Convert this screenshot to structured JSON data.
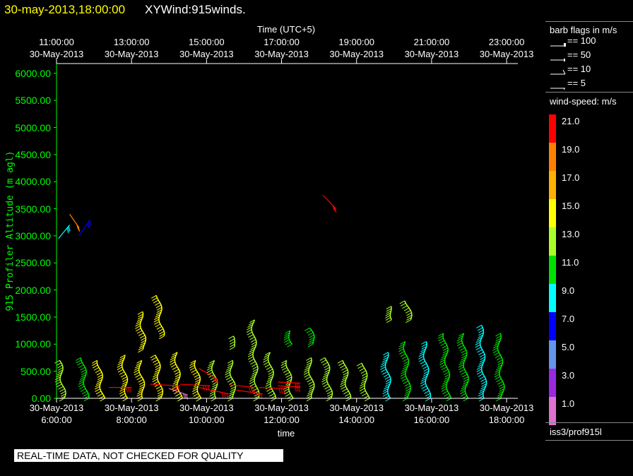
{
  "header": {
    "date": "30-may-2013,18:00:00",
    "title": "XYWind:915winds."
  },
  "chart_data": {
    "type": "wind-barb-time-height",
    "xlabel": "time",
    "x2label": "Time (UTC+5)",
    "ylabel": "915 Profiler Altitude (m agl)",
    "xlim_hours": [
      6.0,
      18.3
    ],
    "ylim": [
      0,
      6180
    ],
    "yticks": [
      "0.00",
      "500.00",
      "1000.00",
      "1500.00",
      "2000.00",
      "2500.00",
      "3000.00",
      "3500.00",
      "4000.00",
      "4500.00",
      "5000.00",
      "5500.00",
      "6000.00"
    ],
    "xticks": [
      {
        "h": 6,
        "date": "30-May-2013",
        "time": "6:00:00"
      },
      {
        "h": 8,
        "date": "30-May-2013",
        "time": "8:00:00"
      },
      {
        "h": 10,
        "date": "30-May-2013",
        "time": "10:00:00"
      },
      {
        "h": 12,
        "date": "30-May-2013",
        "time": "12:00:00"
      },
      {
        "h": 14,
        "date": "30-May-2013",
        "time": "14:00:00"
      },
      {
        "h": 16,
        "date": "30-May-2013",
        "time": "16:00:00"
      },
      {
        "h": 18,
        "date": "30-May-2013",
        "time": "18:00:00"
      }
    ],
    "x2ticks": [
      {
        "h": 6,
        "time": "11:00:00",
        "date": "30-May-2013"
      },
      {
        "h": 8,
        "time": "13:00:00",
        "date": "30-May-2013"
      },
      {
        "h": 10,
        "time": "15:00:00",
        "date": "30-May-2013"
      },
      {
        "h": 12,
        "time": "17:00:00",
        "date": "30-May-2013"
      },
      {
        "h": 14,
        "time": "19:00:00",
        "date": "30-May-2013"
      },
      {
        "h": 16,
        "time": "21:00:00",
        "date": "30-May-2013"
      },
      {
        "h": 18,
        "time": "23:00:00",
        "date": "30-May-2013"
      }
    ],
    "profiles": [
      {
        "t": 6.15,
        "bottom": 0,
        "top": 700,
        "speed": 12
      },
      {
        "t": 6.77,
        "bottom": 0,
        "top": 750,
        "speed": 11
      },
      {
        "t": 7.23,
        "bottom": 0,
        "top": 700,
        "speed": 15
      },
      {
        "t": 7.8,
        "bottom": 0,
        "top": 800,
        "speed": 15
      },
      {
        "t": 8.28,
        "bottom": 0,
        "top": 700,
        "speed": 15
      },
      {
        "t": 8.3,
        "bottom": 900,
        "top": 1600,
        "speed": 15
      },
      {
        "t": 8.77,
        "bottom": 0,
        "top": 800,
        "speed": 15
      },
      {
        "t": 8.8,
        "bottom": 1150,
        "top": 1900,
        "speed": 15
      },
      {
        "t": 9.3,
        "bottom": 0,
        "top": 850,
        "speed": 14
      },
      {
        "t": 9.77,
        "bottom": 0,
        "top": 700,
        "speed": 15
      },
      {
        "t": 10.25,
        "bottom": 0,
        "top": 700,
        "speed": 13
      },
      {
        "t": 10.75,
        "bottom": 0,
        "top": 700,
        "speed": 13
      },
      {
        "t": 10.77,
        "bottom": 950,
        "top": 1150,
        "speed": 13
      },
      {
        "t": 11.28,
        "bottom": 0,
        "top": 1450,
        "speed": 13
      },
      {
        "t": 11.75,
        "bottom": 0,
        "top": 850,
        "speed": 13
      },
      {
        "t": 12.26,
        "bottom": 0,
        "top": 700,
        "speed": 13
      },
      {
        "t": 12.28,
        "bottom": 1000,
        "top": 1250,
        "speed": 11
      },
      {
        "t": 12.77,
        "bottom": 0,
        "top": 750,
        "speed": 12
      },
      {
        "t": 12.79,
        "bottom": 1000,
        "top": 1300,
        "speed": 11
      },
      {
        "t": 13.26,
        "bottom": 0,
        "top": 750,
        "speed": 13
      },
      {
        "t": 13.77,
        "bottom": 0,
        "top": 700,
        "speed": 12
      },
      {
        "t": 14.3,
        "bottom": 0,
        "top": 650,
        "speed": 12
      },
      {
        "t": 14.83,
        "bottom": 0,
        "top": 850,
        "speed": 9
      },
      {
        "t": 14.9,
        "bottom": 1450,
        "top": 1700,
        "speed": 13
      },
      {
        "t": 15.36,
        "bottom": 0,
        "top": 1050,
        "speed": 11
      },
      {
        "t": 15.4,
        "bottom": 1450,
        "top": 1800,
        "speed": 13
      },
      {
        "t": 15.9,
        "bottom": 0,
        "top": 1050,
        "speed": 9
      },
      {
        "t": 16.38,
        "bottom": 0,
        "top": 1200,
        "speed": 10
      },
      {
        "t": 16.9,
        "bottom": 0,
        "top": 1200,
        "speed": 10
      },
      {
        "t": 17.4,
        "bottom": 0,
        "top": 1350,
        "speed": 9
      },
      {
        "t": 17.9,
        "bottom": 0,
        "top": 1200,
        "speed": 10
      }
    ],
    "segments": [
      {
        "t0": 7.4,
        "a0": 200,
        "t1": 8.0,
        "a1": 200,
        "speed": 21
      },
      {
        "t0": 8.5,
        "a0": 260,
        "t1": 9.3,
        "a1": 230,
        "speed": 21
      },
      {
        "t0": 9.3,
        "a0": 260,
        "t1": 10.1,
        "a1": 230,
        "speed": 21
      },
      {
        "t0": 9.8,
        "a0": 550,
        "t1": 10.3,
        "a1": 350,
        "speed": 21
      },
      {
        "t0": 9.8,
        "a0": 200,
        "t1": 10.6,
        "a1": 80,
        "speed": 21
      },
      {
        "t0": 10.6,
        "a0": 250,
        "t1": 11.3,
        "a1": 200,
        "speed": 21
      },
      {
        "t0": 10.8,
        "a0": 150,
        "t1": 11.5,
        "a1": 80,
        "speed": 21
      },
      {
        "t0": 11.4,
        "a0": 200,
        "t1": 12.1,
        "a1": 180,
        "speed": 21
      },
      {
        "t0": 11.9,
        "a0": 300,
        "t1": 12.5,
        "a1": 280,
        "speed": 21
      },
      {
        "t0": 11.9,
        "a0": 230,
        "t1": 12.5,
        "a1": 210,
        "speed": 21
      },
      {
        "t0": 9.0,
        "a0": 180,
        "t1": 9.5,
        "a1": 60,
        "speed": 1
      },
      {
        "t0": 6.05,
        "a0": 2950,
        "t1": 6.35,
        "a1": 3200,
        "speed": 9
      },
      {
        "t0": 6.35,
        "a0": 3400,
        "t1": 6.6,
        "a1": 3150,
        "speed": 19
      },
      {
        "t0": 6.6,
        "a0": 3000,
        "t1": 6.9,
        "a1": 3300,
        "speed": 7
      },
      {
        "t0": 13.1,
        "a0": 3750,
        "t1": 13.45,
        "a1": 3500,
        "speed": 21
      }
    ]
  },
  "legend": {
    "barb_title": "barb flags in m/s",
    "barbs": [
      {
        "label": "== 100",
        "kind": "flag100"
      },
      {
        "label": "== 50",
        "kind": "flag50"
      },
      {
        "label": "== 10",
        "kind": "full"
      },
      {
        "label": "== 5",
        "kind": "half"
      }
    ],
    "speed_title": "wind-speed: m/s",
    "scale": [
      {
        "value": "21.0",
        "color": "#ff0000"
      },
      {
        "value": "19.0",
        "color": "#ff8000"
      },
      {
        "value": "17.0",
        "color": "#ffb000"
      },
      {
        "value": "15.0",
        "color": "#ffff00"
      },
      {
        "value": "13.0",
        "color": "#a8ff28"
      },
      {
        "value": "11.0",
        "color": "#00e000"
      },
      {
        "value": "9.0",
        "color": "#00ffff"
      },
      {
        "value": "7.0",
        "color": "#0000ff"
      },
      {
        "value": "5.0",
        "color": "#6495ed"
      },
      {
        "value": "3.0",
        "color": "#9a28e0"
      },
      {
        "value": "1.0",
        "color": "#e070d0"
      }
    ],
    "source": "iss3/prof915l"
  },
  "footer": {
    "note": "REAL-TIME DATA, NOT CHECKED FOR QUALITY"
  }
}
